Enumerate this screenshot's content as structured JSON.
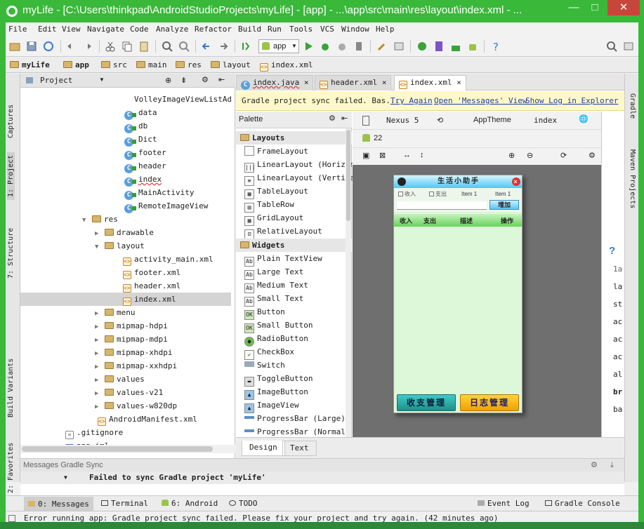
{
  "window": {
    "title": "myLife - [C:\\Users\\thinkpad\\AndroidStudioProjects\\myLife] - [app] - ...\\app\\src\\main\\res\\layout\\index.xml - ...",
    "min": "—",
    "max": "□",
    "close": "✕"
  },
  "menu": [
    "File",
    "Edit",
    "View",
    "Navigate",
    "Code",
    "Analyze",
    "Refactor",
    "Build",
    "Run",
    "Tools",
    "VCS",
    "Window",
    "Help"
  ],
  "toolbar": {
    "run_config": "app"
  },
  "breadcrumb": [
    "myLife",
    "app",
    "src",
    "main",
    "res",
    "layout",
    "index.xml"
  ],
  "left_tabs": [
    "1: Project",
    "Captures",
    "7: Structure",
    "Build Variants",
    "2: Favorites"
  ],
  "right_tabs": [
    "Gradle",
    "Maven Projects"
  ],
  "project_panel": {
    "title": "Project"
  },
  "tree": [
    {
      "label": "VolleyImageViewListAda",
      "kind": "class"
    },
    {
      "label": "data",
      "kind": "class"
    },
    {
      "label": "db",
      "kind": "class"
    },
    {
      "label": "Dict",
      "kind": "class"
    },
    {
      "label": "footer",
      "kind": "class"
    },
    {
      "label": "header",
      "kind": "class"
    },
    {
      "label": "index",
      "kind": "class"
    },
    {
      "label": "MainActivity",
      "kind": "class"
    },
    {
      "label": "RemoteImageView",
      "kind": "class"
    },
    {
      "label": "res",
      "kind": "folder"
    },
    {
      "label": "drawable",
      "kind": "folder"
    },
    {
      "label": "layout",
      "kind": "folder"
    },
    {
      "label": "activity_main.xml",
      "kind": "xml"
    },
    {
      "label": "footer.xml",
      "kind": "xml"
    },
    {
      "label": "header.xml",
      "kind": "xml"
    },
    {
      "label": "index.xml",
      "kind": "xml"
    },
    {
      "label": "menu",
      "kind": "folder"
    },
    {
      "label": "mipmap-hdpi",
      "kind": "folder"
    },
    {
      "label": "mipmap-mdpi",
      "kind": "folder"
    },
    {
      "label": "mipmap-xhdpi",
      "kind": "folder"
    },
    {
      "label": "mipmap-xxhdpi",
      "kind": "folder"
    },
    {
      "label": "values",
      "kind": "folder"
    },
    {
      "label": "values-v21",
      "kind": "folder"
    },
    {
      "label": "values-w820dp",
      "kind": "folder"
    },
    {
      "label": "AndroidManifest.xml",
      "kind": "xml"
    },
    {
      "label": ".gitignore",
      "kind": "file"
    },
    {
      "label": "app.iml",
      "kind": "file"
    }
  ],
  "file_tabs": [
    "index.java",
    "header.xml",
    "index.xml"
  ],
  "notice": {
    "text": "Gradle project sync failed. Bas...",
    "try_again": "Try Again",
    "open_messages": "Open 'Messages' View",
    "show_log": "Show Log in Explorer"
  },
  "palette": {
    "title": "Palette",
    "groups": [
      {
        "name": "Layouts",
        "items": [
          "FrameLayout",
          "LinearLayout (Horizont",
          "LinearLayout (Vertical",
          "TableLayout",
          "TableRow",
          "GridLayout",
          "RelativeLayout"
        ]
      },
      {
        "name": "Widgets",
        "items": [
          "Plain TextView",
          "Large Text",
          "Medium Text",
          "Small Text",
          "Button",
          "Small Button",
          "RadioButton",
          "CheckBox",
          "Switch",
          "ToggleButton",
          "ImageButton",
          "ImageView",
          "ProgressBar (Large)",
          "ProgressBar (Normal)"
        ]
      }
    ]
  },
  "designer": {
    "device": "Nexus 5",
    "theme": "AppTheme",
    "activity": "index",
    "api": "22"
  },
  "phone": {
    "title": "生活小助手",
    "cb_income": "收入",
    "cb_expense": "支出",
    "item1": "Item 1",
    "item2": "Item 1",
    "add_button": "增加",
    "col_income": "收入",
    "col_expense": "支出",
    "col_desc": "描述",
    "col_op": "操作",
    "btn_left": "收支管理",
    "btn_right": "日志管理"
  },
  "design_tabs": [
    "Design",
    "Text"
  ],
  "messages": {
    "header": "Messages Gradle Sync",
    "error": "Failed to sync Gradle project 'myLife'"
  },
  "bottom_tabs": [
    "0: Messages",
    "Terminal",
    "6: Android",
    "TODO",
    "Event Log",
    "Gradle Console"
  ],
  "status": "Error running app: Gradle project sync failed. Please fix your project and try again. (42 minutes ago)",
  "props_fragments": [
    "1a",
    "la",
    "st",
    "ac",
    "ac",
    "ac",
    "al",
    "br",
    "ba"
  ],
  "colors": {
    "window_green": "#3ab83a",
    "notice_bg": "#fff9c9",
    "link": "#1f3ea8"
  }
}
